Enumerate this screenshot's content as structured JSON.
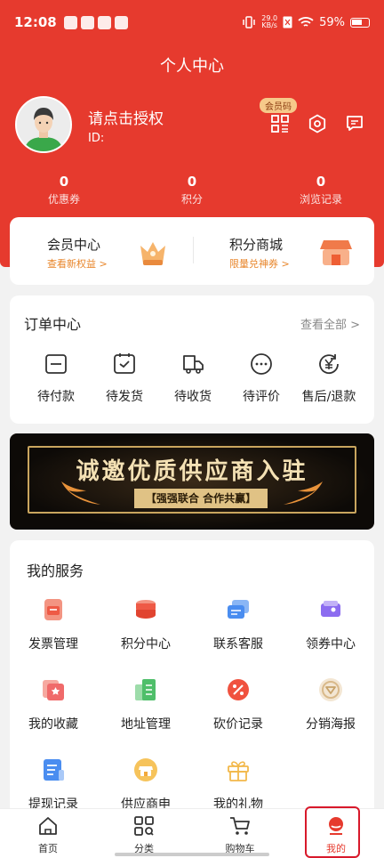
{
  "status": {
    "time": "12:08",
    "speed_top": "29.0",
    "speed_unit": "KB/s",
    "battery": "59%"
  },
  "page_title": "个人中心",
  "user": {
    "name": "请点击授权",
    "id_label": "ID:"
  },
  "member_code_badge": "会员码",
  "stats": [
    {
      "value": "0",
      "label": "优惠券"
    },
    {
      "value": "0",
      "label": "积分"
    },
    {
      "value": "0",
      "label": "浏览记录"
    }
  ],
  "member_card": {
    "member_center": {
      "title": "会员中心",
      "subtitle": "查看新权益 >"
    },
    "points_mall": {
      "title": "积分商城",
      "subtitle": "限量兑神券 >"
    }
  },
  "orders": {
    "title": "订单中心",
    "see_all": "查看全部 >",
    "items": [
      {
        "label": "待付款",
        "icon": "wallet-icon"
      },
      {
        "label": "待发货",
        "icon": "box-icon"
      },
      {
        "label": "待收货",
        "icon": "truck-icon"
      },
      {
        "label": "待评价",
        "icon": "chat-icon"
      },
      {
        "label": "售后/退款",
        "icon": "refund-icon"
      }
    ]
  },
  "banner": {
    "title": "诚邀优质供应商入驻",
    "subtitle": "【强强联合 合作共赢】"
  },
  "services": {
    "title": "我的服务",
    "items": [
      {
        "label": "发票管理",
        "icon": "invoice-icon",
        "color": "#f06a55"
      },
      {
        "label": "积分中心",
        "icon": "coins-icon",
        "color": "#ee5a46"
      },
      {
        "label": "联系客服",
        "icon": "service-icon",
        "color": "#4a8df0"
      },
      {
        "label": "领券中心",
        "icon": "coupon-icon",
        "color": "#8c6cf0"
      },
      {
        "label": "我的收藏",
        "icon": "favorite-icon",
        "color": "#f06a6a"
      },
      {
        "label": "地址管理",
        "icon": "address-icon",
        "color": "#4fbf6a"
      },
      {
        "label": "砍价记录",
        "icon": "bargain-icon",
        "color": "#f0523f"
      },
      {
        "label": "分销海报",
        "icon": "poster-icon",
        "color": "#d9b98a"
      },
      {
        "label": "提现记录",
        "icon": "withdraw-icon",
        "color": "#4a8df0"
      },
      {
        "label": "供应商申",
        "icon": "supplier-icon",
        "color": "#f2a93b"
      },
      {
        "label": "我的礼物",
        "icon": "gift-icon",
        "color": "#f2b84a"
      }
    ]
  },
  "tabs": [
    {
      "label": "首页",
      "icon": "home-icon"
    },
    {
      "label": "分类",
      "icon": "category-icon"
    },
    {
      "label": "购物车",
      "icon": "cart-icon"
    },
    {
      "label": "我的",
      "icon": "profile-icon",
      "active": true
    }
  ],
  "colors": {
    "brand_red": "#e63a2e",
    "accent_orange": "#e8862b"
  }
}
